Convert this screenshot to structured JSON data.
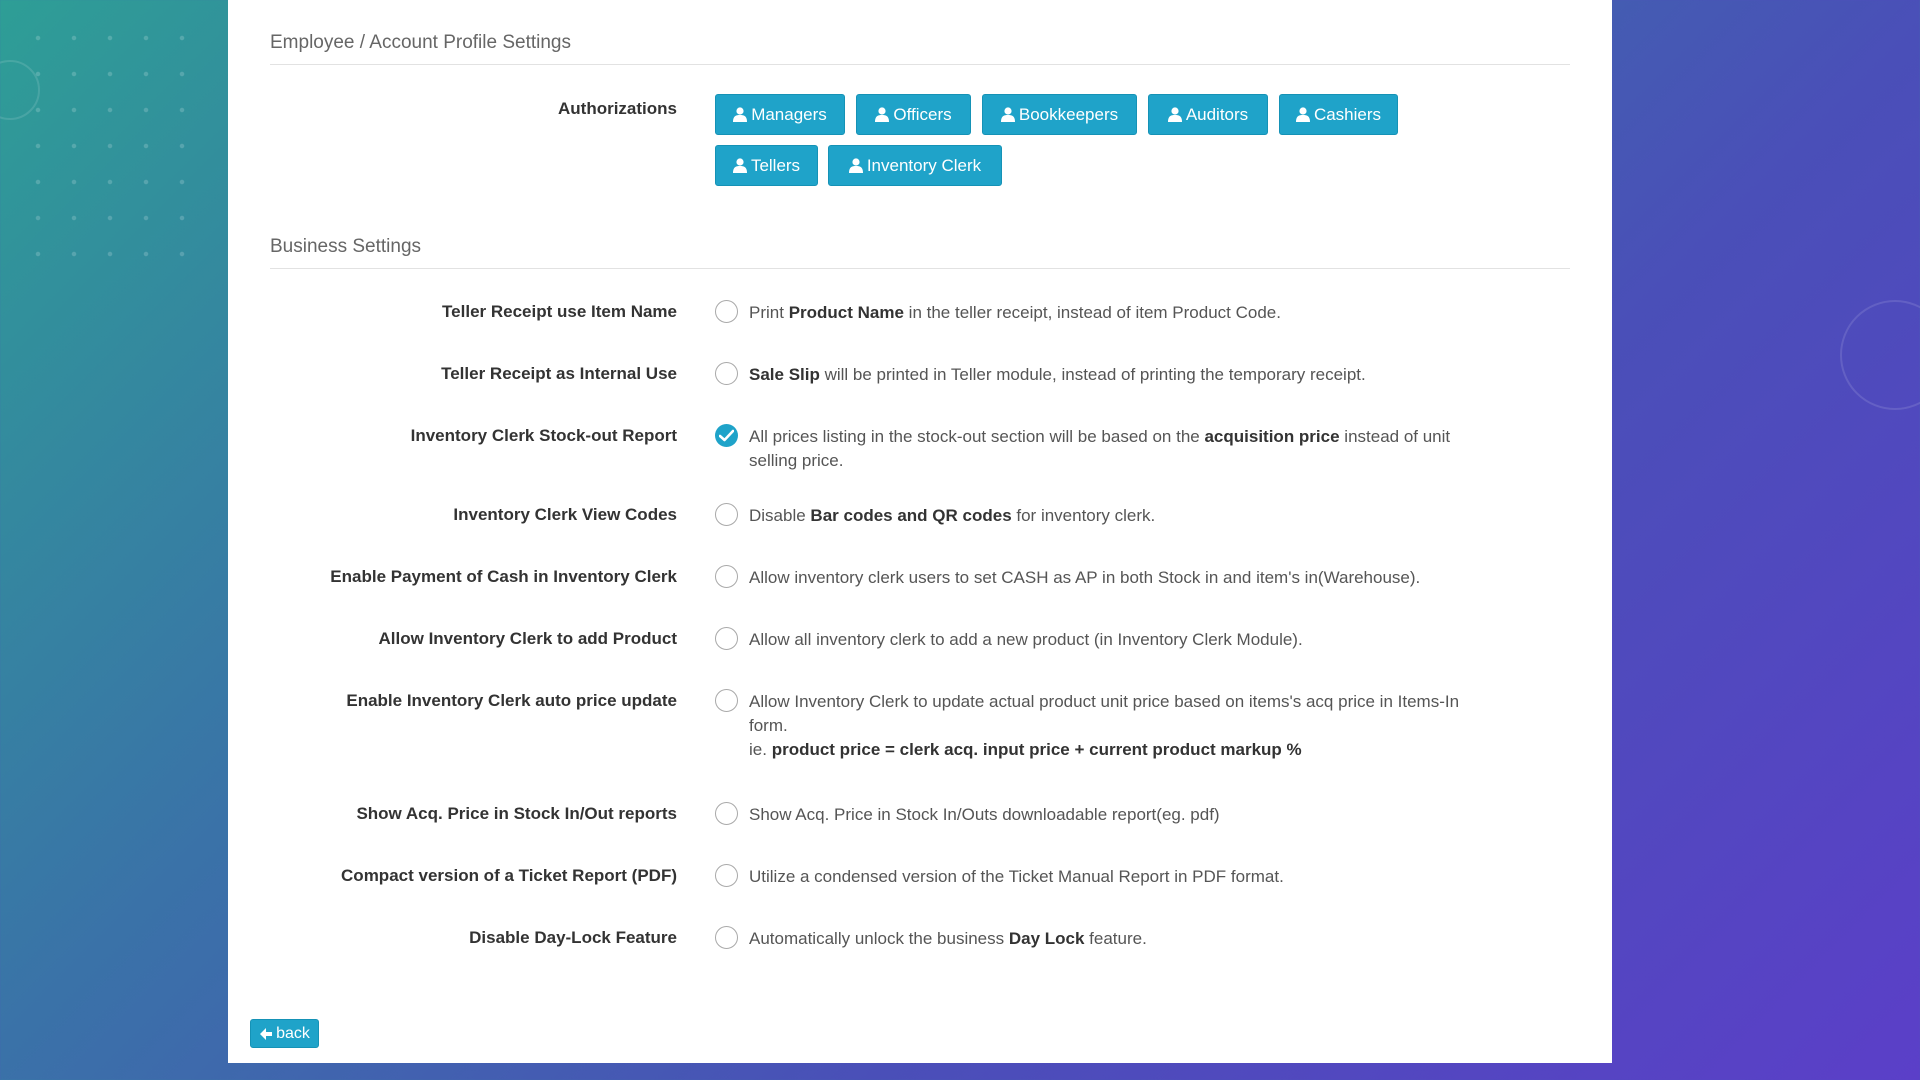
{
  "sections": {
    "employee_title": "Employee / Account Profile Settings",
    "business_title": "Business Settings"
  },
  "authorizations": {
    "label": "Authorizations",
    "buttons": [
      "Managers",
      "Officers",
      "Bookkeepers",
      "Auditors",
      "Cashiers",
      "Tellers",
      "Inventory Clerk"
    ]
  },
  "settings": [
    {
      "label": "Teller Receipt use Item Name",
      "checked": false,
      "desc": [
        [
          "Print ",
          false
        ],
        [
          "Product Name",
          true
        ],
        [
          " in the teller receipt, instead of item Product Code.",
          false
        ]
      ]
    },
    {
      "label": "Teller Receipt as Internal Use",
      "checked": false,
      "desc": [
        [
          "Sale Slip",
          true
        ],
        [
          " will be printed in Teller module, instead of printing the temporary receipt.",
          false
        ]
      ]
    },
    {
      "label": "Inventory Clerk Stock-out Report",
      "checked": true,
      "desc": [
        [
          "All prices listing in the stock-out section will be based on the ",
          false
        ],
        [
          "acquisition price",
          true
        ],
        [
          " instead of unit selling price.",
          false
        ]
      ]
    },
    {
      "label": "Inventory Clerk View Codes",
      "checked": false,
      "desc": [
        [
          "Disable ",
          false
        ],
        [
          "Bar codes and QR codes",
          true
        ],
        [
          " for inventory clerk.",
          false
        ]
      ]
    },
    {
      "label": "Enable Payment of Cash in Inventory Clerk",
      "checked": false,
      "desc": [
        [
          "Allow inventory clerk users to set CASH as AP in both Stock in and item's in(Warehouse).",
          false
        ]
      ]
    },
    {
      "label": "Allow Inventory Clerk to add Product",
      "checked": false,
      "desc": [
        [
          "Allow all inventory clerk to add a new product (in Inventory Clerk Module).",
          false
        ]
      ]
    },
    {
      "label": "Enable Inventory Clerk auto price update",
      "checked": false,
      "desc": [
        [
          "Allow Inventory Clerk to update actual product unit price based on items's acq price in Items-In form.",
          false
        ],
        [
          "\n",
          false
        ],
        [
          "ie. ",
          false
        ],
        [
          "product price = clerk acq. input price + current product markup %",
          true
        ]
      ]
    },
    {
      "label": "Show Acq. Price in Stock In/Out reports",
      "checked": false,
      "desc": [
        [
          "Show Acq. Price in Stock In/Outs downloadable report(eg. pdf)",
          false
        ]
      ]
    },
    {
      "label": "Compact version of a Ticket Report (PDF)",
      "checked": false,
      "desc": [
        [
          "Utilize a condensed version of the Ticket Manual Report in PDF format.",
          false
        ]
      ]
    },
    {
      "label": "Disable Day-Lock Feature",
      "checked": false,
      "desc": [
        [
          "Automatically unlock the business ",
          false
        ],
        [
          "Day Lock",
          true
        ],
        [
          " feature.",
          false
        ]
      ]
    }
  ],
  "back_label": "back",
  "icons": {
    "user": "user-icon",
    "back": "arrow-left-icon",
    "check": "check-icon"
  },
  "colors": {
    "accent": "#1fa3c9",
    "background_start": "#2e9e96",
    "background_end": "#5b3fc8"
  }
}
